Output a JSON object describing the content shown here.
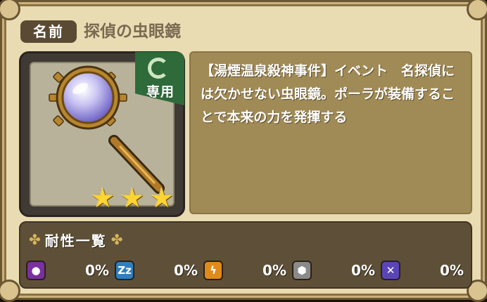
{
  "item": {
    "name_label": "名前",
    "name": "探偵の虫眼鏡",
    "exclusive_label": "専用",
    "rarity_stars": 3,
    "description": "【湯煙温泉殺神事件】イベント　名探偵には欠かせない虫眼鏡。ポーラが装備することで本来の力を発揮する"
  },
  "resistance": {
    "title": "耐性一覧",
    "items": [
      {
        "icon": "poison-icon",
        "color": "#7b2fa0",
        "glyph": "●",
        "value": "0%"
      },
      {
        "icon": "sleep-icon",
        "color": "#2f7fc0",
        "glyph": "Zz",
        "value": "0%"
      },
      {
        "icon": "paralysis-icon",
        "color": "#e08a1a",
        "glyph": "ϟ",
        "value": "0%"
      },
      {
        "icon": "seal-icon",
        "color": "#8a8a8a",
        "glyph": "⬢",
        "value": "0%"
      },
      {
        "icon": "curse-icon",
        "color": "#5a45b8",
        "glyph": "✕",
        "value": "0%"
      }
    ]
  }
}
